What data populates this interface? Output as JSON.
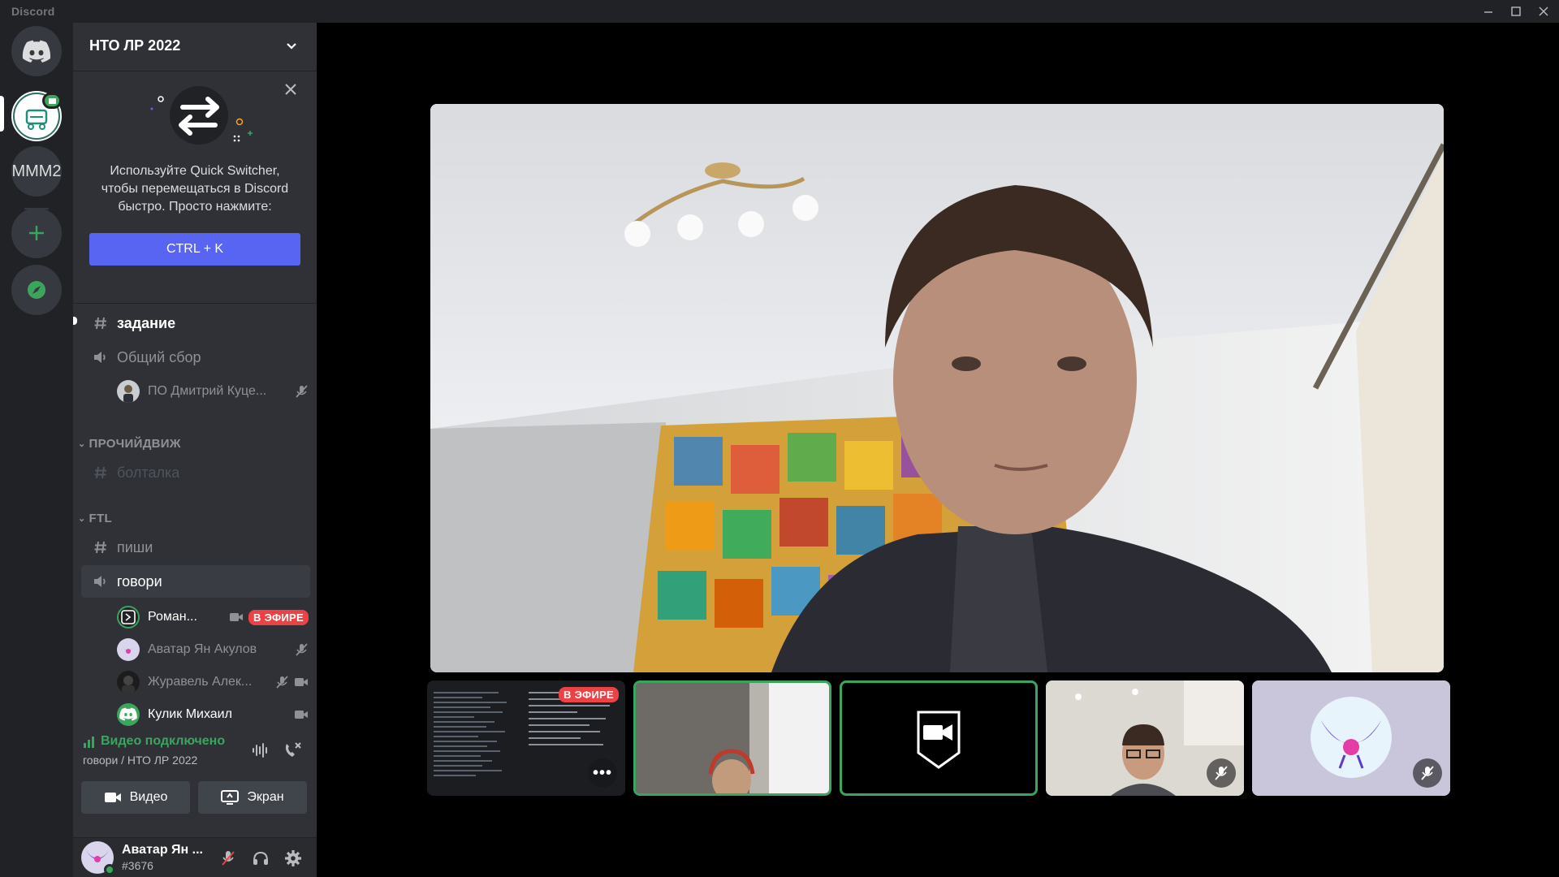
{
  "app": {
    "title": "Discord"
  },
  "servers": [
    {
      "label": ""
    },
    {
      "label": "MMM2"
    }
  ],
  "server": {
    "name": "НТО ЛР 2022"
  },
  "quick_switcher": {
    "text_line1": "Используйте Quick Switcher,",
    "text_line2": "чтобы перемещаться в Discord",
    "text_line3": "быстро. Просто нажмите:",
    "button": "CTRL + K"
  },
  "channels": {
    "zadanie": "задание",
    "obshchiy_sbor": "Общий сбор",
    "obshchiy_sbor_user": "ПО Дмитрий Куце...",
    "category1": "ПРОЧИЙДВИЖ",
    "boltalka": "болталка",
    "category2": "FTL",
    "pishi": "пиши",
    "govori": "говори",
    "govori_users": [
      {
        "name": "Роман...",
        "badge": "В ЭФИРЕ"
      },
      {
        "name": "Аватар Ян Акулов"
      },
      {
        "name": "Журавель Алек..."
      },
      {
        "name": "Кулик Михаил"
      }
    ]
  },
  "voice": {
    "status": "Видео подключено",
    "location": "говори / НТО ЛР 2022",
    "video_button": "Видео",
    "screen_button": "Экран"
  },
  "user": {
    "name": "Аватар Ян ...",
    "tag": "#3676",
    "status_color": "#3ba55d"
  },
  "tiles": {
    "live_badge": "В ЭФИРЕ",
    "more": "•••"
  },
  "colors": {
    "accent": "#5865f2",
    "green": "#3ba55d",
    "red": "#ed4245"
  }
}
